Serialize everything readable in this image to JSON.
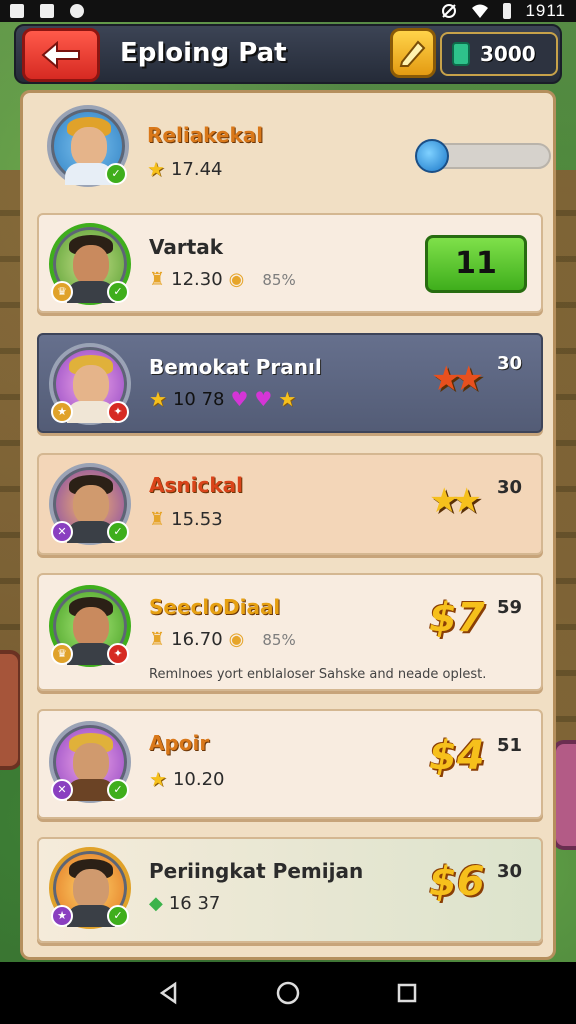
{
  "status_bar": {
    "time": "1911",
    "left_icons": [
      "screenshot-icon",
      "image-icon",
      "location-icon"
    ],
    "right_icons": [
      "mute-icon",
      "wifi-icon",
      "battery-icon"
    ]
  },
  "header": {
    "title": "Eploing Pat",
    "back_icon": "back-arrow-icon",
    "edit_icon": "pencil-icon",
    "currency_icon": "gem-icon",
    "currency_value": "3000"
  },
  "top_entry": {
    "name": "Reliakekal",
    "score": "17.44",
    "progress": 0.18
  },
  "entries": [
    {
      "name": "Vartak",
      "score": "12.30",
      "extra": "85%",
      "action_label": "11",
      "style": "plain"
    },
    {
      "name": "Bemokat Pranıl",
      "score": "10 78",
      "right_num": "30",
      "style": "purple"
    },
    {
      "name": "Asnickal",
      "score": "15.53",
      "right_num": "30",
      "style": "tan"
    },
    {
      "name": "SeecloDiaal",
      "score": "16.70",
      "extra": "85%",
      "big_num": "$7",
      "right_num": "59",
      "description": "Remlnoes yort enblaloser Sahske and neade oplest.",
      "style": "plain"
    },
    {
      "name": "Apoir",
      "score": "10.20",
      "big_num": "$4",
      "right_num": "51",
      "style": "plain"
    },
    {
      "name": "Periingkat Pemijan",
      "score": "16 37",
      "big_num": "$6",
      "right_num": "30",
      "style": "green"
    }
  ],
  "colors": {
    "accent_red": "#d62a22",
    "accent_green": "#3fae1c",
    "gold": "#f6c01c",
    "panel_bg": "#f1dfc4"
  },
  "nav": {
    "back_icon": "nav-back-icon",
    "home_icon": "nav-home-icon",
    "recents_icon": "nav-recents-icon"
  }
}
